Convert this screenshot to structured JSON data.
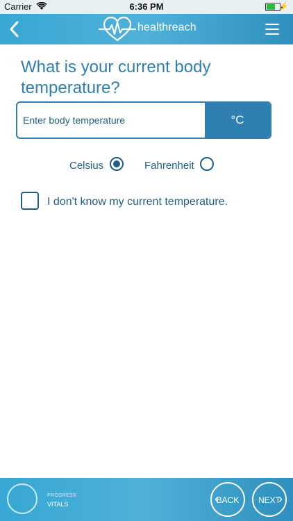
{
  "status_bar": {
    "carrier": "Carrier",
    "time": "6:36 PM"
  },
  "nav": {
    "brand": "healthreach",
    "back_icon": "chevron-left-icon",
    "menu_icon": "hamburger-menu-icon",
    "logo_icon": "heart-pulse-logo-icon"
  },
  "question": {
    "title": "What is your current body temperature?"
  },
  "temperature_input": {
    "placeholder": "Enter body temperature",
    "value": "",
    "unit": "°C"
  },
  "units": {
    "options": [
      {
        "label": "Celsius",
        "selected": true
      },
      {
        "label": "Fahrenheit",
        "selected": false
      }
    ]
  },
  "dont_know": {
    "label": "I don't know my current temperature.",
    "checked": false
  },
  "footer": {
    "progress_caption": "PROGRESS",
    "progress_section": "VITALS",
    "back_label": "BACK",
    "next_label": "NEXT"
  },
  "colors": {
    "primary": "#2f7fb1",
    "text": "#1f5f86",
    "bar_gradient_start": "#37a7d4",
    "bar_gradient_end": "#2f8fbe"
  }
}
